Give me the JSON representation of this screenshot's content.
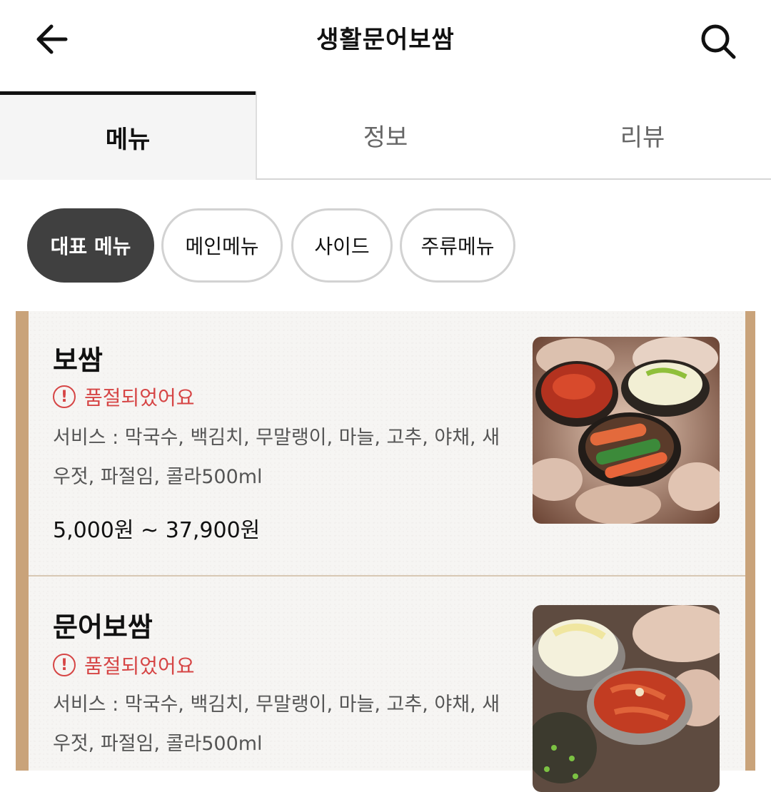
{
  "header": {
    "title": "생활문어보쌈",
    "back_icon": "arrow-left-icon",
    "search_icon": "search-icon"
  },
  "tabs": [
    {
      "label": "메뉴",
      "active": true
    },
    {
      "label": "정보",
      "active": false
    },
    {
      "label": "리뷰",
      "active": false
    }
  ],
  "chips": [
    {
      "label": "대표 메뉴",
      "active": true
    },
    {
      "label": "메인메뉴",
      "active": false
    },
    {
      "label": "사이드",
      "active": false
    },
    {
      "label": "주류메뉴",
      "active": false
    }
  ],
  "menu_items": [
    {
      "name": "보쌈",
      "status": "품절되었어요",
      "description": "서비스 : 막국수, 백김치, 무말랭이, 마늘, 고추, 야채, 새우젓, 파절임, 콜라500ml",
      "price": "5,000원 ~ 37,900원"
    },
    {
      "name": "문어보쌈",
      "status": "품절되었어요",
      "description": "서비스 : 막국수, 백김치, 무말랭이, 마늘, 고추, 야채, 새우젓, 파절임, 콜라500ml",
      "price": ""
    }
  ],
  "colors": {
    "accent_soldout": "#d64545",
    "active_chip": "#404040",
    "frame_wood": "#c9a37a"
  }
}
